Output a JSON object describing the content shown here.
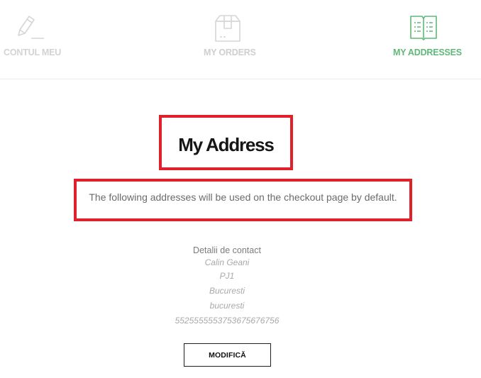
{
  "tabs": [
    {
      "label": "CONTUL MEU",
      "icon": "pencil-icon",
      "active": false
    },
    {
      "label": "MY ORDERS",
      "icon": "box-icon",
      "active": false
    },
    {
      "label": "MY ADDRESSES",
      "icon": "book-icon",
      "active": true
    }
  ],
  "colors": {
    "active": "#5fb878",
    "inactive": "#d3d3d3",
    "highlight_border": "#e0202a"
  },
  "main": {
    "title": "My Address",
    "description": "The following addresses will be used on the checkout page by default."
  },
  "contact": {
    "heading": "Detalii de contact",
    "lines": [
      "Calin Geani",
      "PJ1",
      "Bucuresti",
      "bucuresti",
      "5525555553753675676756"
    ]
  },
  "edit_button": {
    "label": "MODIFICĂ"
  }
}
